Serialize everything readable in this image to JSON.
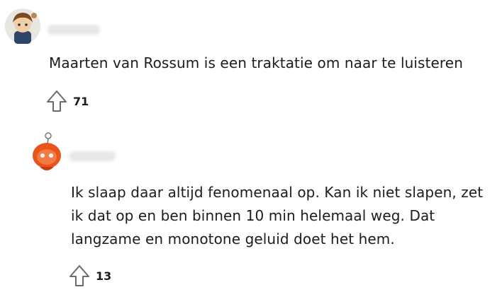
{
  "comments": [
    {
      "text": "Maarten van Rossum is een traktatie om naar te luisteren",
      "upvotes": "71",
      "icons": {
        "avatar": "user-avatar-icon",
        "upvote": "upvote-arrow-icon"
      }
    },
    {
      "text": "Ik slaap daar altijd fenomenaal op. Kan ik niet slapen, zet ik dat op en ben binnen 10 min helemaal weg. Dat langzame en monotone geluid doet het hem.",
      "upvotes": "13",
      "icons": {
        "avatar": "user-avatar-icon",
        "upvote": "upvote-arrow-icon"
      }
    }
  ],
  "colors": {
    "text": "#1c1c1c",
    "icon_stroke": "#6b6b6b",
    "avatar2_orange": "#e8541b"
  }
}
